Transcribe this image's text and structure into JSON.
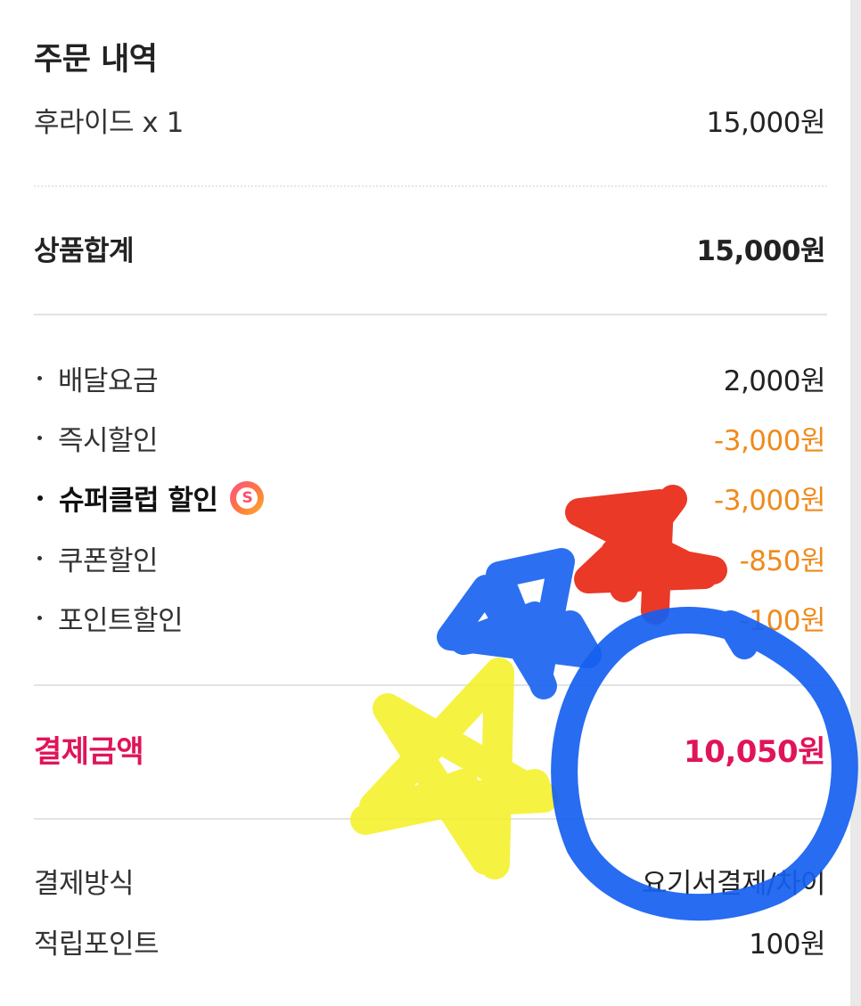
{
  "order": {
    "title": "주문 내역",
    "item": {
      "label": "후라이드 x 1",
      "value": "15,000원"
    }
  },
  "subtotal": {
    "label": "상품합계",
    "value": "15,000원"
  },
  "fees": [
    {
      "label": "배달요금",
      "value": "2,000원"
    },
    {
      "label": "즉시할인",
      "value": "-3,000원"
    },
    {
      "label": "슈퍼클럽 할인",
      "value": "-3,000원",
      "badge_letter": "S"
    },
    {
      "label": "쿠폰할인",
      "value": "-850원"
    },
    {
      "label": "포인트할인",
      "value": "-100원"
    }
  ],
  "total": {
    "label": "결제금액",
    "value": "10,050원"
  },
  "payment": {
    "method_label": "결제방식",
    "method_value": "요기서결제/차이",
    "points_label": "적립포인트",
    "points_value": "100원"
  },
  "colors": {
    "discount": "#f08a1c",
    "total": "#e0145a",
    "scribble_blue": "#1560f0",
    "scribble_red": "#e8230f",
    "scribble_yellow": "#f5f020"
  }
}
